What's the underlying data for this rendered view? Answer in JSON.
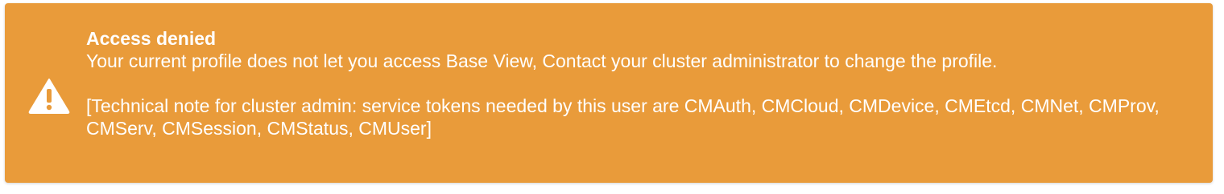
{
  "alert": {
    "icon": "warning-triangle-icon",
    "background_color": "#E99B3A",
    "text_color": "#FFFFFF",
    "title": "Access denied",
    "message": "Your current profile does not let you access Base View, Contact your cluster administrator to change the profile.",
    "technical_note": "[Technical note for cluster admin: service tokens needed by this user are CMAuth, CMCloud, CMDevice, CMEtcd, CMNet, CMProv, CMServ, CMSession, CMStatus, CMUser]"
  }
}
